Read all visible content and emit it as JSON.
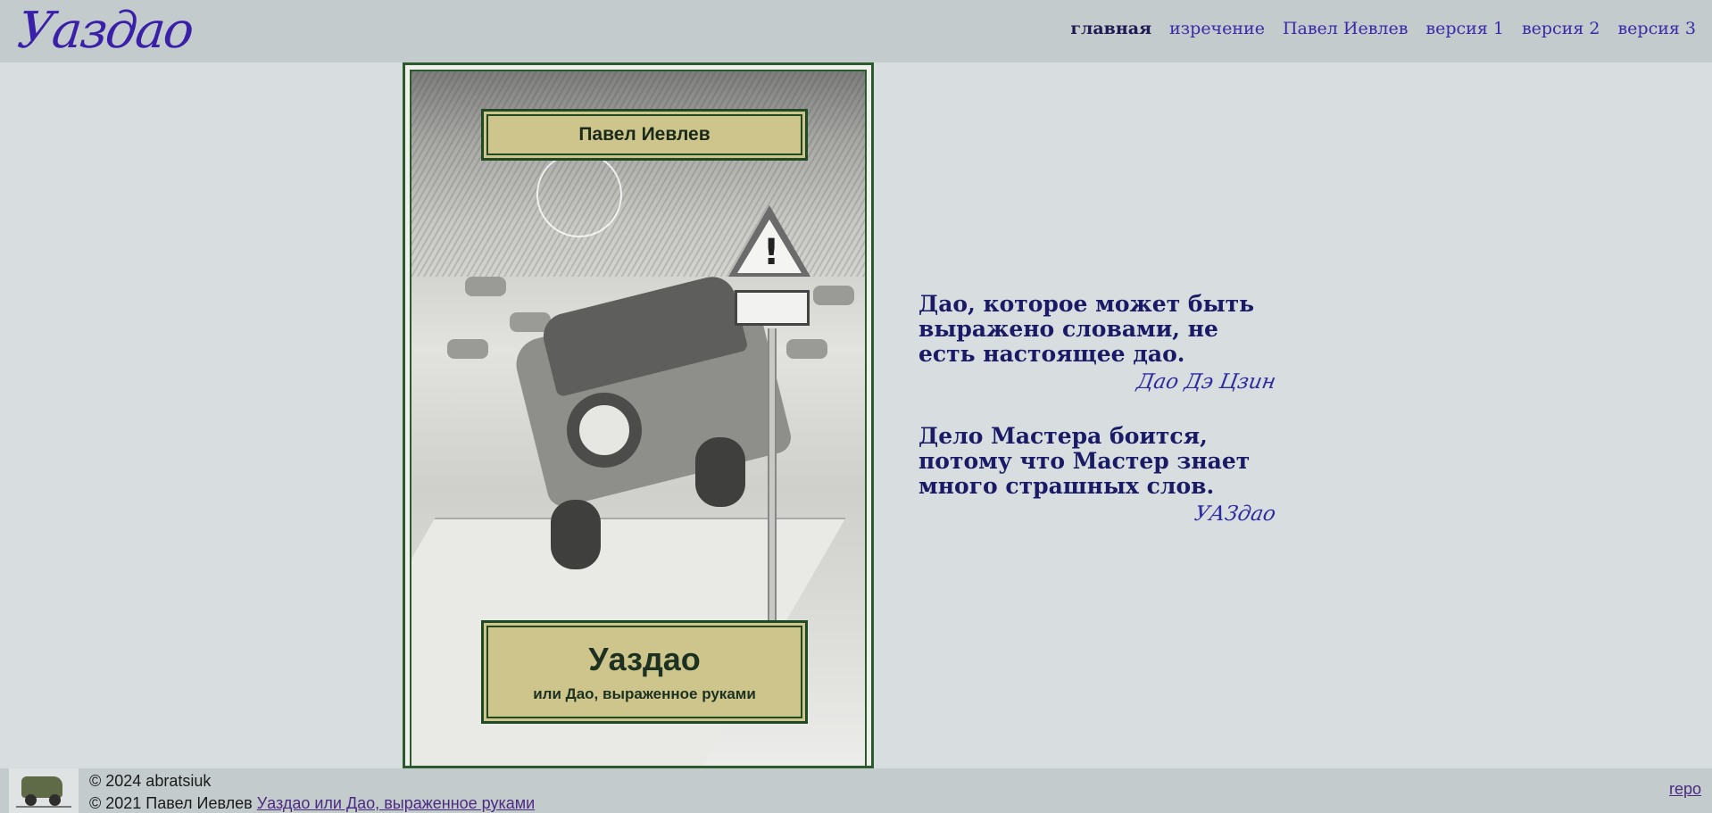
{
  "header": {
    "logo": "Уаздао",
    "nav": [
      {
        "label": "главная",
        "active": true
      },
      {
        "label": "изречение",
        "active": false
      },
      {
        "label": "Павел Иевлев",
        "active": false
      },
      {
        "label": "версия 1",
        "active": false
      },
      {
        "label": "версия 2",
        "active": false
      },
      {
        "label": "версия 3",
        "active": false
      }
    ]
  },
  "cover": {
    "author": "Павел Иевлев",
    "title": "Уаздао",
    "subtitle": "или Дао, выраженное руками"
  },
  "quotes": [
    {
      "text": "Дао, которое может быть выражено словами, не есть настоящее дао.",
      "author": "Дао Дэ Цзин"
    },
    {
      "text": "Дело Мастера боится, потому что Мастер знает много страшных слов.",
      "author": "УАЗдао"
    }
  ],
  "footer": {
    "copyright_current": "© 2024 abratsiuk",
    "copyright_original_prefix": "© 2021 Павел Иевлев",
    "book_link": "Уаздао или Дао, выраженное руками",
    "repo_link": "repo"
  },
  "colors": {
    "header_bg": "#c3cbcc",
    "page_bg": "#d8dedf",
    "accent": "#3a1fa8",
    "quote_text": "#1a1a66",
    "cover_frame": "#2b5a2e",
    "cover_box": "#cdc58c"
  }
}
